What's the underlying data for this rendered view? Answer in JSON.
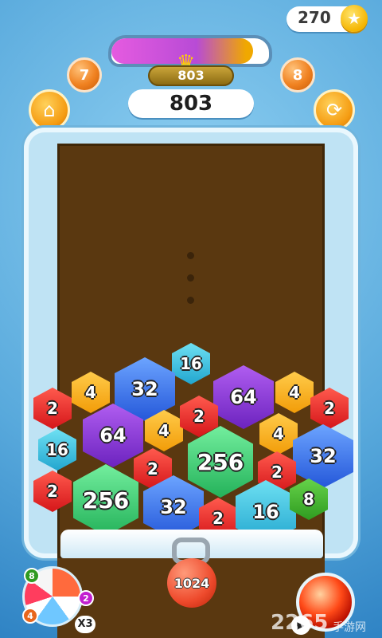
{
  "hud": {
    "coins": "270",
    "coin_icon": "star-coin-icon",
    "progress_fraction": 0.9,
    "best_score": "803",
    "score": "803",
    "left_orb": "7",
    "right_orb": "8",
    "shop_icon": "shop-icon",
    "refresh_icon": "refresh-icon"
  },
  "board": {
    "tiles": [
      {
        "value": "16",
        "color": "#22a6cf"
      },
      {
        "value": "4",
        "color": "#f29c08"
      },
      {
        "value": "32",
        "color": "#2457d9"
      },
      {
        "value": "64",
        "color": "#6c23bf"
      },
      {
        "value": "4",
        "color": "#f29c08"
      },
      {
        "value": "2",
        "color": "#d5161a"
      },
      {
        "value": "2",
        "color": "#d5161a"
      },
      {
        "value": "64",
        "color": "#6c23bf"
      },
      {
        "value": "4",
        "color": "#f29c08"
      },
      {
        "value": "2",
        "color": "#d5161a"
      },
      {
        "value": "4",
        "color": "#f29c08"
      },
      {
        "value": "16",
        "color": "#22a6cf"
      },
      {
        "value": "256",
        "color": "#24b25a"
      },
      {
        "value": "32",
        "color": "#2457d9"
      },
      {
        "value": "2",
        "color": "#d5161a"
      },
      {
        "value": "2",
        "color": "#d5161a"
      },
      {
        "value": "2",
        "color": "#d5161a"
      },
      {
        "value": "256",
        "color": "#24b25a"
      },
      {
        "value": "32",
        "color": "#2457d9"
      },
      {
        "value": "2",
        "color": "#d5161a"
      },
      {
        "value": "16",
        "color": "#22a6cf"
      },
      {
        "value": "8",
        "color": "#2f9b20"
      }
    ]
  },
  "launcher": {
    "next_value": "1024"
  },
  "powerups": {
    "bonus_values": [
      "8",
      "2",
      "4"
    ],
    "bonus_multiplier": "X3",
    "bomb_icon": "bomb-icon",
    "play_icon": "play-icon"
  },
  "watermark": {
    "text": "2265",
    "site": "手游网"
  }
}
